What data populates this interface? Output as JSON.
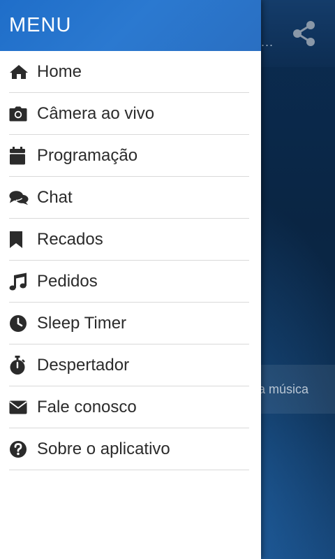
{
  "drawer": {
    "title": "MENU",
    "items": [
      {
        "label": "Home",
        "icon": "home-icon"
      },
      {
        "label": "Câmera ao vivo",
        "icon": "camera-icon"
      },
      {
        "label": "Programação",
        "icon": "calendar-icon"
      },
      {
        "label": "Chat",
        "icon": "comments-icon"
      },
      {
        "label": "Recados",
        "icon": "bookmark-icon"
      },
      {
        "label": "Pedidos",
        "icon": "music-icon"
      },
      {
        "label": "Sleep Timer",
        "icon": "clock-icon"
      },
      {
        "label": "Despertador",
        "icon": "stopwatch-icon"
      },
      {
        "label": "Fale conosco",
        "icon": "envelope-icon"
      },
      {
        "label": "Sobre o aplicativo",
        "icon": "question-circle-icon"
      }
    ]
  },
  "background": {
    "banner_text": "a música",
    "more_dots": "..."
  },
  "colors": {
    "header_blue": "#2b79d0",
    "text": "#2b2b2b",
    "divider": "#d9d9d9"
  }
}
